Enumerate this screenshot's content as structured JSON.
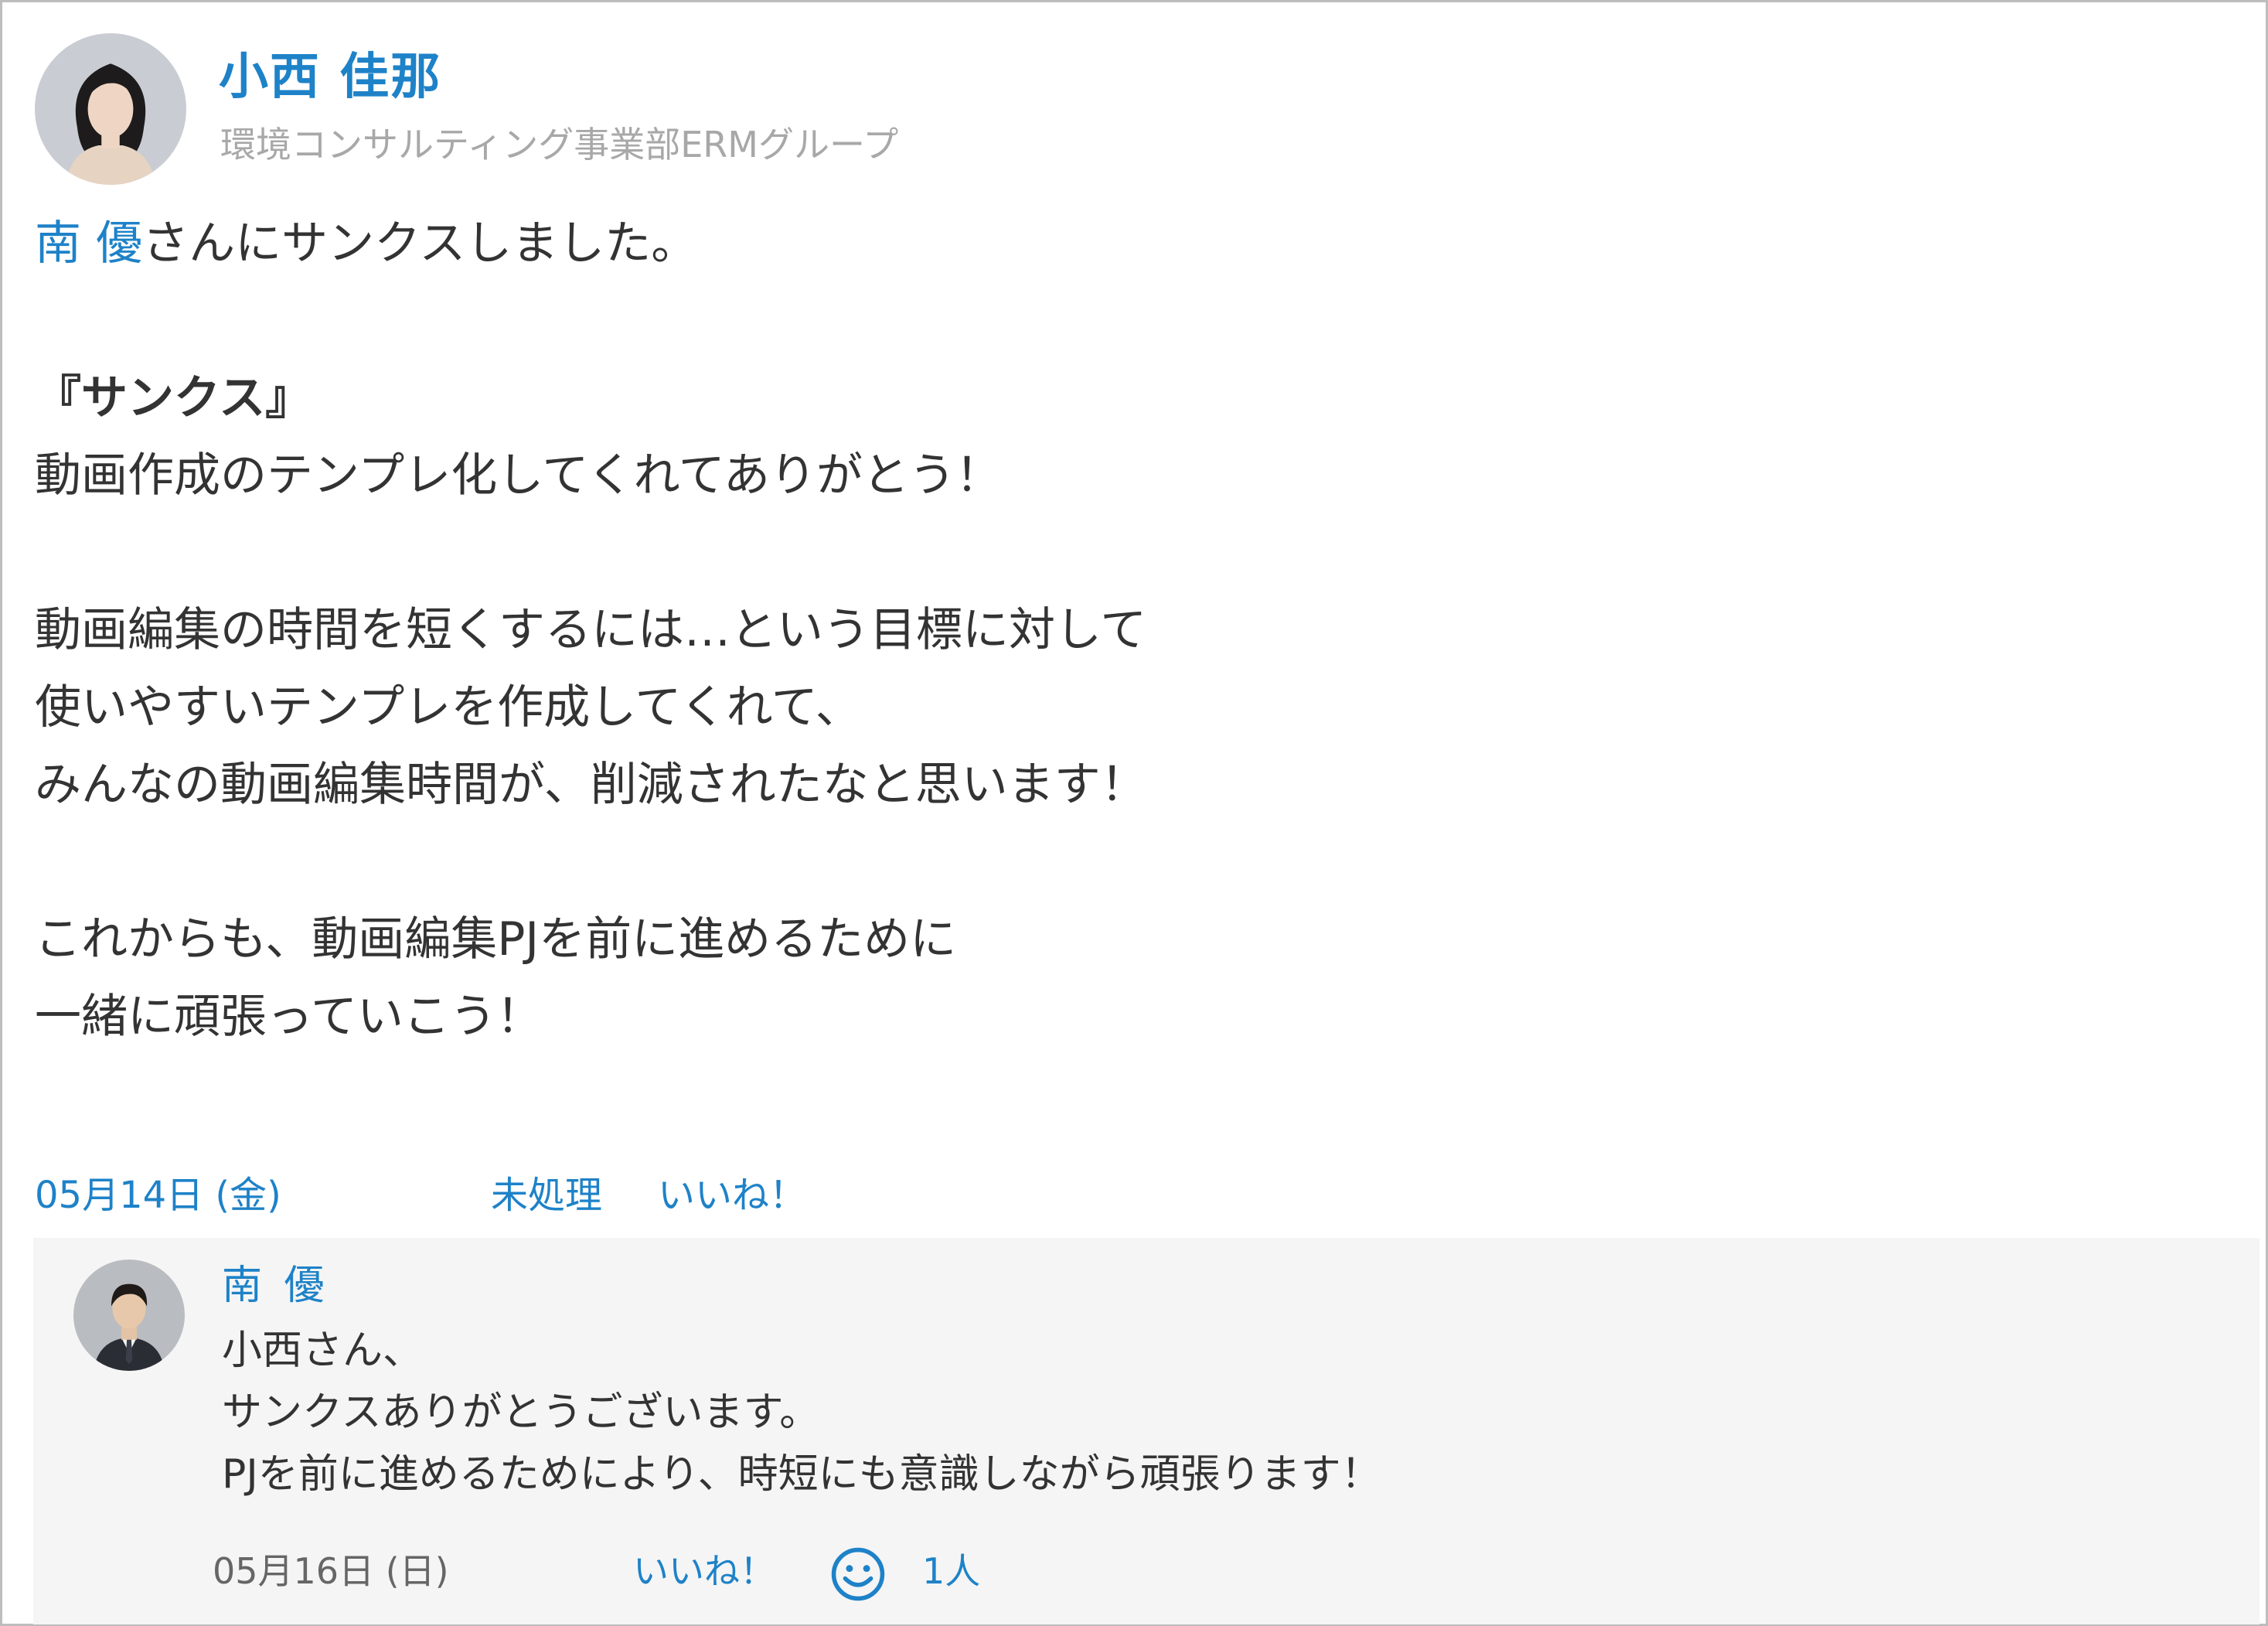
{
  "post": {
    "author": {
      "name": "小西 佳那",
      "department": "環境コンサルティング事業部ERMグループ"
    },
    "mention_name": "南 優",
    "mention_suffix": "さんにサンクスしました。",
    "thanks_title": "『サンクス』",
    "lines": [
      "動画作成のテンプレ化してくれてありがとう！",
      "",
      "動画編集の時間を短くするには…という目標に対して",
      "使いやすいテンプレを作成してくれて、",
      "みんなの動画編集時間が、削減されたなと思います！",
      "",
      "これからも、動画編集PJを前に進めるために",
      "一緒に頑張っていこう！"
    ],
    "date": "05月14日 (金)",
    "status": "未処理",
    "like_label": "いいね！"
  },
  "comment": {
    "author": "南 優",
    "lines": [
      "小西さん、",
      "サンクスありがとうございます。",
      "PJを前に進めるためにより、時短にも意識しながら頑張ります！"
    ],
    "date": "05月16日 (日)",
    "like_label": "いいね！",
    "like_icon": "smile-icon",
    "like_count": "1人"
  },
  "colors": {
    "link": "#1e82c8",
    "text": "#333333",
    "muted": "#a8a8a8",
    "comment_bg": "#f5f5f5"
  }
}
